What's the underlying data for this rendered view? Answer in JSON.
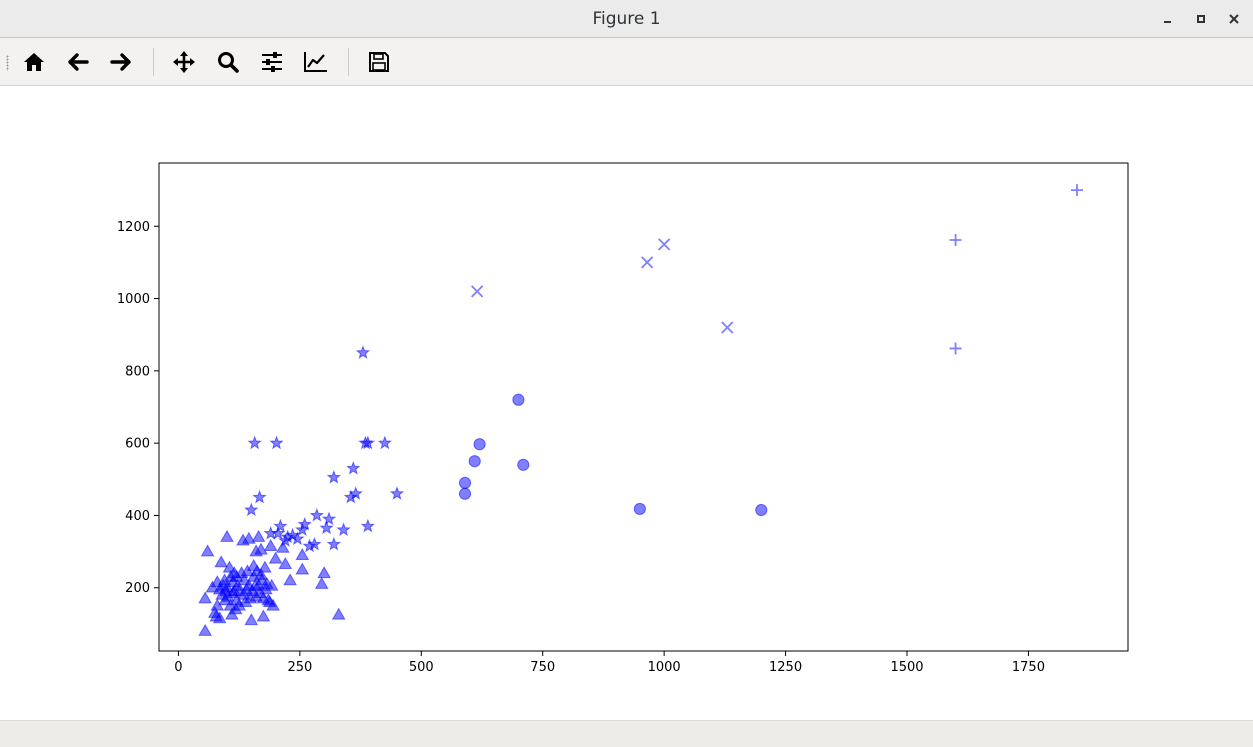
{
  "window": {
    "title": "Figure 1"
  },
  "toolbar": {
    "buttons": [
      {
        "name": "home-icon"
      },
      {
        "name": "back-arrow-icon"
      },
      {
        "name": "forward-arrow-icon"
      },
      {
        "name": "pan-move-icon"
      },
      {
        "name": "zoom-magnifier-icon"
      },
      {
        "name": "configure-subplots-icon"
      },
      {
        "name": "edit-axes-icon"
      },
      {
        "name": "save-figure-icon"
      }
    ]
  },
  "chart_data": {
    "type": "scatter",
    "title": "",
    "xlabel": "",
    "ylabel": "",
    "xlim": [
      -40,
      1955
    ],
    "ylim": [
      25,
      1375
    ],
    "xticks": [
      0,
      250,
      500,
      750,
      1000,
      1250,
      1500,
      1750
    ],
    "yticks": [
      200,
      400,
      600,
      800,
      1000,
      1200
    ],
    "grid": false,
    "legend": false,
    "color": "#0000ff",
    "alpha": 0.5,
    "series": [
      {
        "marker": "triangle",
        "points": [
          [
            55,
            80
          ],
          [
            55,
            170
          ],
          [
            60,
            300
          ],
          [
            70,
            200
          ],
          [
            75,
            130
          ],
          [
            78,
            120
          ],
          [
            80,
            150
          ],
          [
            80,
            215
          ],
          [
            85,
            115
          ],
          [
            85,
            195
          ],
          [
            88,
            270
          ],
          [
            90,
            180
          ],
          [
            92,
            205
          ],
          [
            95,
            220
          ],
          [
            96,
            165
          ],
          [
            98,
            190
          ],
          [
            100,
            200
          ],
          [
            100,
            340
          ],
          [
            102,
            175
          ],
          [
            105,
            255
          ],
          [
            107,
            150
          ],
          [
            108,
            230
          ],
          [
            110,
            125
          ],
          [
            112,
            215
          ],
          [
            112,
            185
          ],
          [
            115,
            240
          ],
          [
            115,
            190
          ],
          [
            118,
            140
          ],
          [
            120,
            165
          ],
          [
            120,
            230
          ],
          [
            122,
            205
          ],
          [
            125,
            150
          ],
          [
            125,
            190
          ],
          [
            130,
            240
          ],
          [
            133,
            330
          ],
          [
            135,
            220
          ],
          [
            135,
            180
          ],
          [
            138,
            160
          ],
          [
            140,
            195
          ],
          [
            142,
            245
          ],
          [
            145,
            205
          ],
          [
            145,
            335
          ],
          [
            148,
            170
          ],
          [
            150,
            110
          ],
          [
            152,
            190
          ],
          [
            155,
            230
          ],
          [
            155,
            260
          ],
          [
            158,
            205
          ],
          [
            160,
            175
          ],
          [
            160,
            300
          ],
          [
            162,
            245
          ],
          [
            165,
            340
          ],
          [
            165,
            205
          ],
          [
            168,
            185
          ],
          [
            170,
            235
          ],
          [
            170,
            305
          ],
          [
            172,
            220
          ],
          [
            175,
            120
          ],
          [
            175,
            170
          ],
          [
            178,
            255
          ],
          [
            180,
            195
          ],
          [
            182,
            210
          ],
          [
            185,
            165
          ],
          [
            188,
            160
          ],
          [
            190,
            315
          ],
          [
            192,
            205
          ],
          [
            195,
            150
          ],
          [
            200,
            280
          ],
          [
            215,
            310
          ],
          [
            220,
            265
          ],
          [
            230,
            220
          ],
          [
            255,
            250
          ],
          [
            255,
            290
          ],
          [
            295,
            210
          ],
          [
            300,
            240
          ],
          [
            330,
            125
          ]
        ]
      },
      {
        "marker": "star",
        "points": [
          [
            150,
            415
          ],
          [
            157,
            600
          ],
          [
            167,
            450
          ],
          [
            190,
            350
          ],
          [
            202,
            600
          ],
          [
            205,
            350
          ],
          [
            210,
            370
          ],
          [
            220,
            330
          ],
          [
            225,
            340
          ],
          [
            235,
            345
          ],
          [
            245,
            335
          ],
          [
            255,
            360
          ],
          [
            260,
            375
          ],
          [
            270,
            315
          ],
          [
            280,
            320
          ],
          [
            285,
            400
          ],
          [
            305,
            365
          ],
          [
            310,
            390
          ],
          [
            320,
            505
          ],
          [
            320,
            320
          ],
          [
            340,
            360
          ],
          [
            355,
            450
          ],
          [
            360,
            530
          ],
          [
            365,
            460
          ],
          [
            380,
            850
          ],
          [
            385,
            600
          ],
          [
            390,
            600
          ],
          [
            390,
            370
          ],
          [
            425,
            600
          ],
          [
            450,
            460
          ]
        ]
      },
      {
        "marker": "circle",
        "points": [
          [
            590,
            460
          ],
          [
            590,
            490
          ],
          [
            610,
            550
          ],
          [
            620,
            597
          ],
          [
            700,
            720
          ],
          [
            710,
            540
          ],
          [
            950,
            418
          ],
          [
            1200,
            415
          ]
        ]
      },
      {
        "marker": "x",
        "points": [
          [
            615,
            1020
          ],
          [
            965,
            1100
          ],
          [
            1000,
            1150
          ],
          [
            1130,
            920
          ]
        ]
      },
      {
        "marker": "plus",
        "points": [
          [
            1600,
            862
          ],
          [
            1600,
            1162
          ],
          [
            1850,
            1300
          ]
        ]
      }
    ]
  }
}
